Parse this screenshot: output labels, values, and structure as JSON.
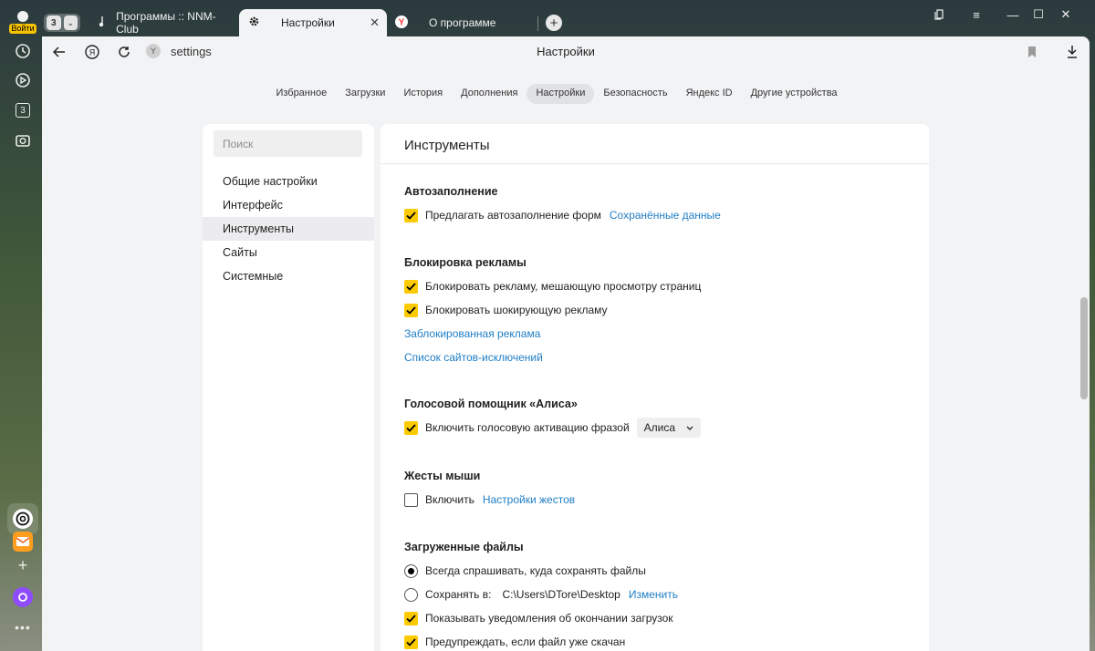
{
  "sidebar": {
    "login_label": "Войти",
    "icons": [
      "clock-icon",
      "play-icon",
      "tab-counter-icon",
      "screenshot-icon",
      "chatgpt-icon",
      "mail-icon",
      "add-icon",
      "alice-icon",
      "more-icon"
    ],
    "counter": "3"
  },
  "tabbar": {
    "tab_count": "3",
    "tabs": [
      {
        "title": "Программы :: NNM-Club",
        "active": false
      },
      {
        "title": "Настройки",
        "active": true
      },
      {
        "title": "О программе",
        "active": false
      }
    ],
    "new_tab_label": "+"
  },
  "addressbar": {
    "url": "settings",
    "page_title": "Настройки"
  },
  "settings_nav": [
    {
      "label": "Избранное",
      "active": false
    },
    {
      "label": "Загрузки",
      "active": false
    },
    {
      "label": "История",
      "active": false
    },
    {
      "label": "Дополнения",
      "active": false
    },
    {
      "label": "Настройки",
      "active": true
    },
    {
      "label": "Безопасность",
      "active": false
    },
    {
      "label": "Яндекс ID",
      "active": false
    },
    {
      "label": "Другие устройства",
      "active": false
    }
  ],
  "left_panel": {
    "search_placeholder": "Поиск",
    "items": [
      {
        "label": "Общие настройки",
        "active": false
      },
      {
        "label": "Интерфейс",
        "active": false
      },
      {
        "label": "Инструменты",
        "active": true
      },
      {
        "label": "Сайты",
        "active": false
      },
      {
        "label": "Системные",
        "active": false
      }
    ]
  },
  "main": {
    "title": "Инструменты",
    "autofill": {
      "title": "Автозаполнение",
      "offer_label": "Предлагать автозаполнение форм",
      "offer_checked": true,
      "saved_link": "Сохранённые данные"
    },
    "adblock": {
      "title": "Блокировка рекламы",
      "block_intrusive_label": "Блокировать рекламу, мешающую просмотру страниц",
      "block_intrusive_checked": true,
      "block_shocking_label": "Блокировать шокирующую рекламу",
      "block_shocking_checked": true,
      "blocked_link": "Заблокированная реклама",
      "exceptions_link": "Список сайтов-исключений"
    },
    "alice": {
      "title": "Голосовой помощник «Алиса»",
      "voice_label": "Включить голосовую активацию фразой",
      "voice_checked": true,
      "phrase_value": "Алиса"
    },
    "gestures": {
      "title": "Жесты мыши",
      "enable_label": "Включить",
      "enable_checked": false,
      "settings_link": "Настройки жестов"
    },
    "downloads": {
      "title": "Загруженные файлы",
      "always_ask_label": "Всегда спрашивать, куда сохранять файлы",
      "always_ask_selected": true,
      "save_to_label": "Сохранять в:",
      "save_to_path": "C:\\Users\\DTore\\Desktop",
      "change_link": "Изменить",
      "notify_label": "Показывать уведомления об окончании загрузок",
      "notify_checked": true,
      "warn_label": "Предупреждать, если файл уже скачан",
      "warn_checked": true
    }
  },
  "colors": {
    "accent_checkbox": "#fcca00",
    "link": "#1f7ec6",
    "window_bg": "#f2f3f5"
  }
}
